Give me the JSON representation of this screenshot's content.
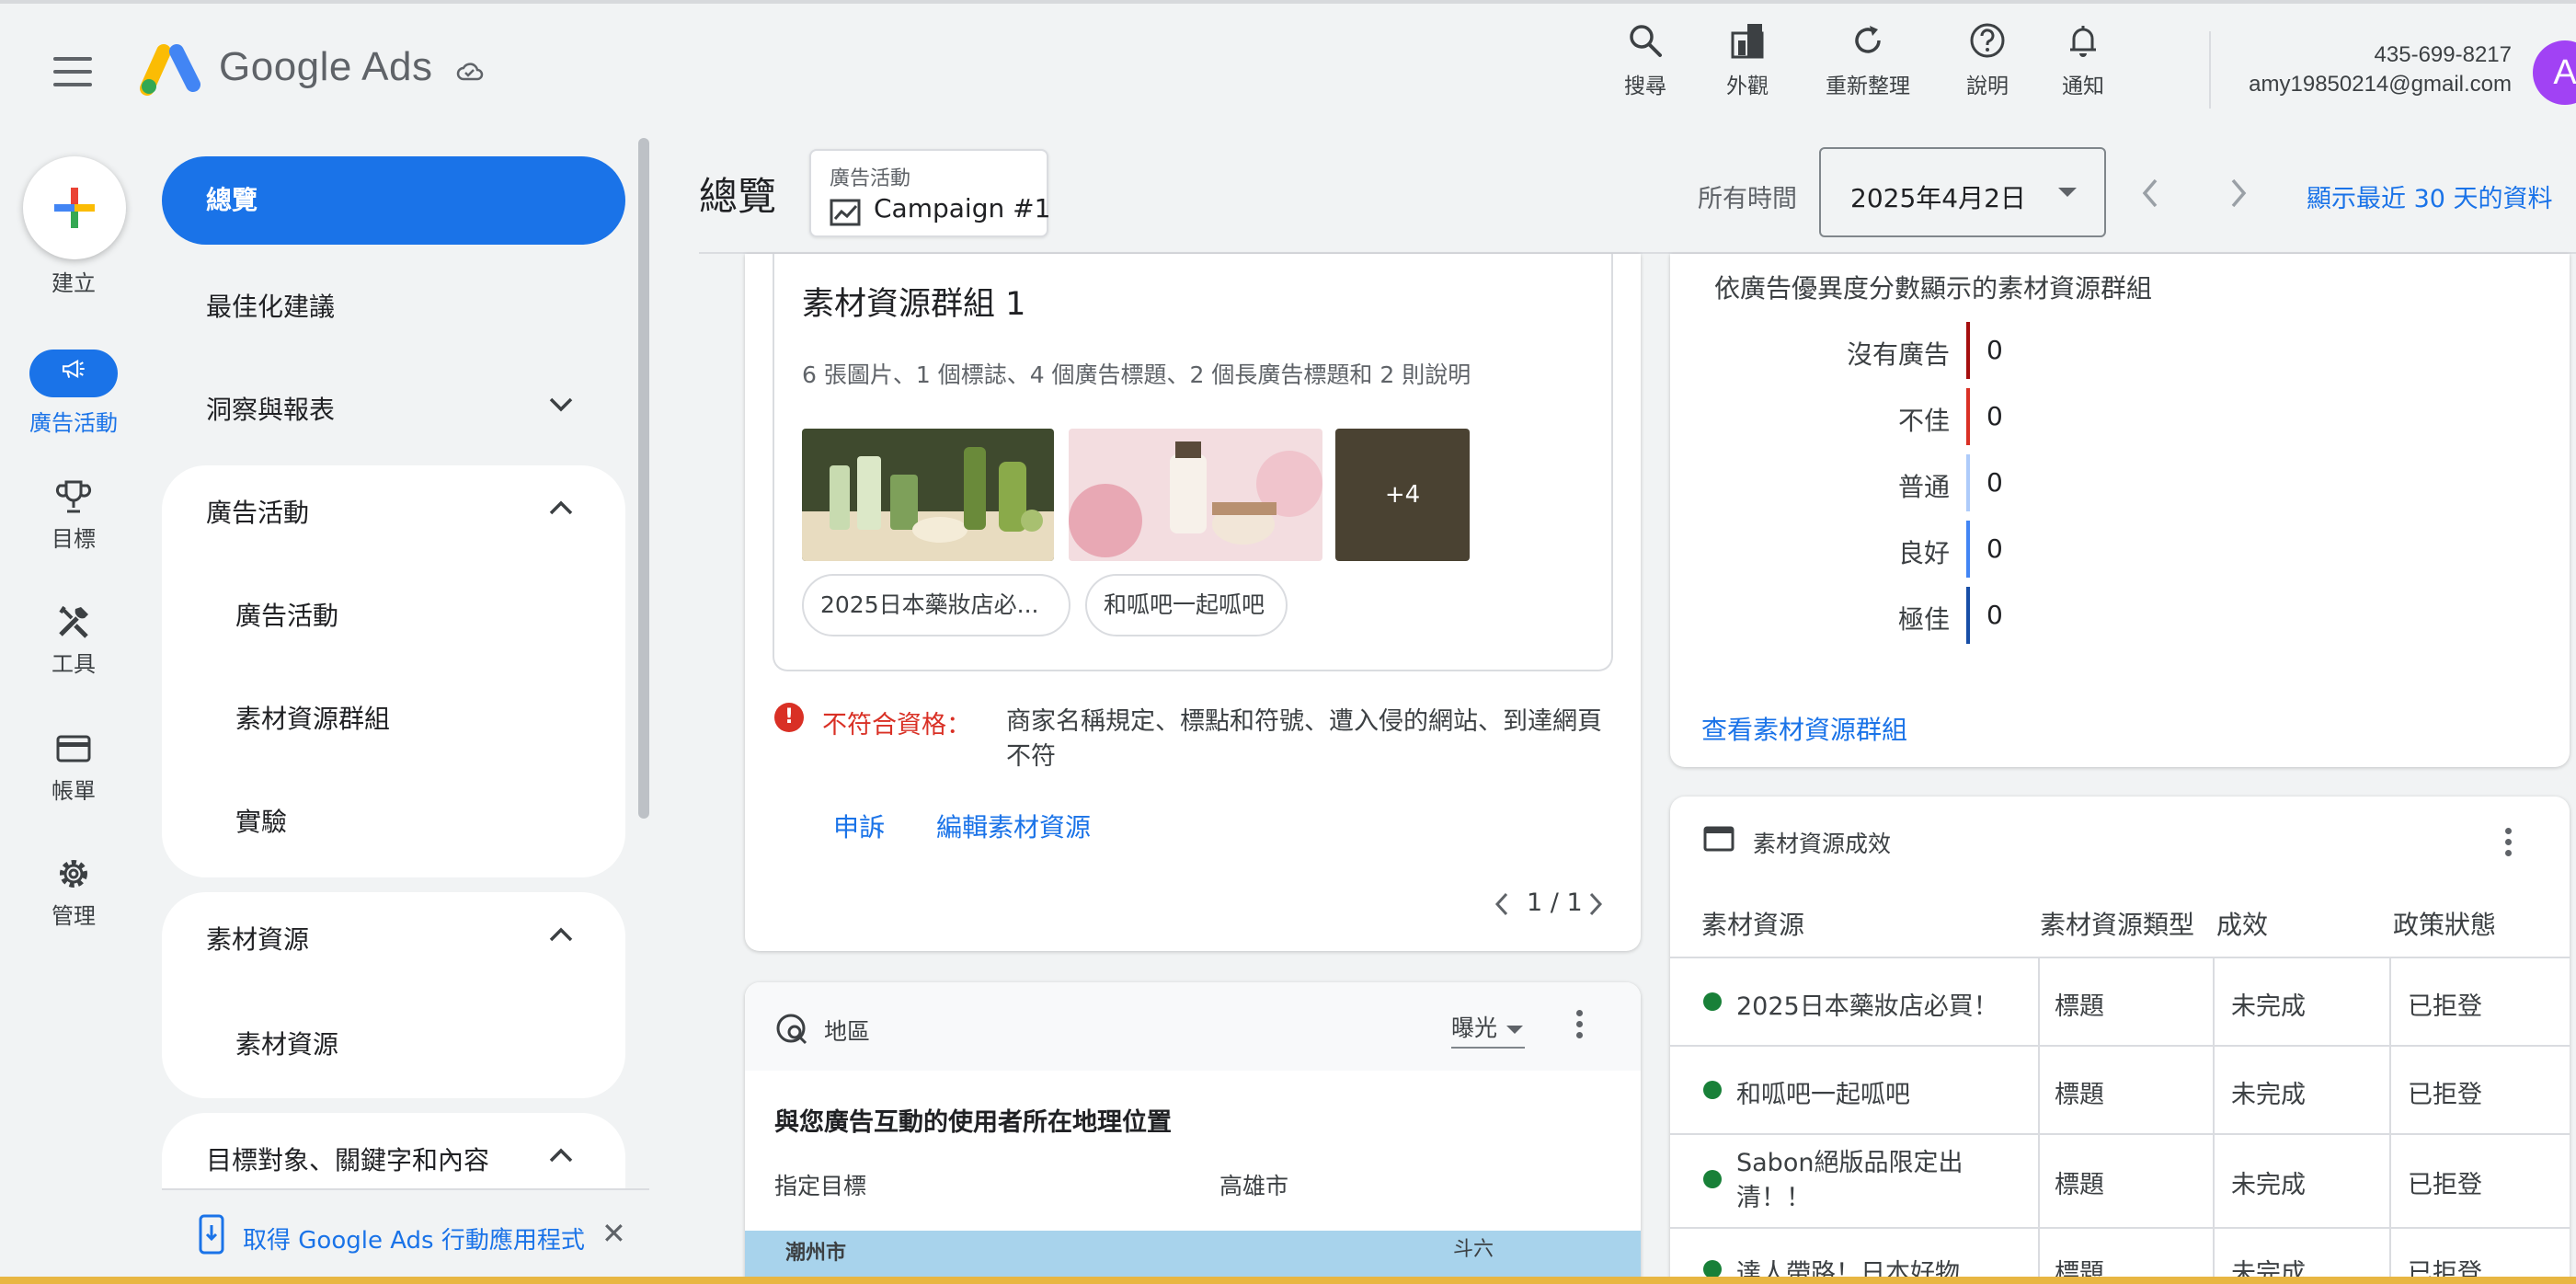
{
  "header": {
    "app_name": "Google Ads",
    "tools": [
      {
        "label": "搜尋",
        "icon": "search-icon"
      },
      {
        "label": "外觀",
        "icon": "appearance-icon"
      },
      {
        "label": "重新整理",
        "icon": "refresh-icon"
      },
      {
        "label": "說明",
        "icon": "help-icon"
      },
      {
        "label": "通知",
        "icon": "bell-icon"
      }
    ],
    "account_id": "435-699-8217",
    "email": "amy19850214@gmail.com",
    "avatar_letter": "A"
  },
  "rail": {
    "create_label": "建立",
    "items": [
      {
        "label": "廣告活動",
        "icon": "megaphone-icon",
        "active": true
      },
      {
        "label": "目標",
        "icon": "trophy-icon"
      },
      {
        "label": "工具",
        "icon": "tools-icon"
      },
      {
        "label": "帳單",
        "icon": "credit-card-icon"
      },
      {
        "label": "管理",
        "icon": "gear-icon"
      }
    ]
  },
  "nav": {
    "overview": "總覽",
    "recommendations": "最佳化建議",
    "insights": "洞察與報表",
    "campaigns_section": "廣告活動",
    "campaigns_items": [
      "廣告活動",
      "素材資源群組",
      "實驗"
    ],
    "assets_section": "素材資源",
    "assets_items": [
      "素材資源"
    ],
    "audiences_section": "目標對象、關鍵字和內容",
    "app_banner": "取得 Google Ads 行動應用程式"
  },
  "topbar": {
    "title": "總覽",
    "campaign_label": "廣告活動",
    "campaign_name": "Campaign #1",
    "all_time": "所有時間",
    "date": "2025年4月2日",
    "recent_link": "顯示最近 30 天的資料"
  },
  "asset_group": {
    "title": "素材資源群組 1",
    "summary": "6 張圖片、1 個標誌、4 個廣告標題、2 個長廣告標題和 2 則說明",
    "more_images": "+4",
    "chips": [
      "2025日本藥妝店必...",
      "和呱吧一起呱吧"
    ],
    "error_label": "不符合資格：",
    "error_text": "商家名稱規定、標點和符號、遭入侵的網站、到達網頁不符",
    "appeal": "申訴",
    "edit": "編輯素材資源",
    "pager": "1 / 1"
  },
  "region": {
    "title": "地區",
    "metric": "曝光",
    "subtitle": "與您廣告互動的使用者所在地理位置",
    "col1": "指定目標",
    "col2": "高雄市",
    "map_label_1": "潮州市",
    "map_label_2": "斗六"
  },
  "quality": {
    "title": "依廣告優異度分數顯示的素材資源群組",
    "rows": [
      {
        "label": "沒有廣告",
        "value": "0",
        "color": "#a50e0e"
      },
      {
        "label": "不佳",
        "value": "0",
        "color": "#d93025"
      },
      {
        "label": "普通",
        "value": "0",
        "color": "#aecbfa"
      },
      {
        "label": "良好",
        "value": "0",
        "color": "#4285f4"
      },
      {
        "label": "極佳",
        "value": "0",
        "color": "#174ea6"
      }
    ],
    "view_link": "查看素材資源群組"
  },
  "performance": {
    "title": "素材資源成效",
    "headers": [
      "素材資源",
      "素材資源類型",
      "成效",
      "政策狀態"
    ],
    "rows": [
      {
        "asset": "2025日本藥妝店必買！",
        "type": "標題",
        "perf": "未完成",
        "policy": "已拒登"
      },
      {
        "asset": "和呱吧一起呱吧",
        "type": "標題",
        "perf": "未完成",
        "policy": "已拒登"
      },
      {
        "asset": "Sabon絕版品限定出清！！",
        "type": "標題",
        "perf": "未完成",
        "policy": "已拒登"
      },
      {
        "asset": "達人帶路！日本好物",
        "type": "標題",
        "perf": "未完成",
        "policy": "已拒登"
      }
    ]
  }
}
